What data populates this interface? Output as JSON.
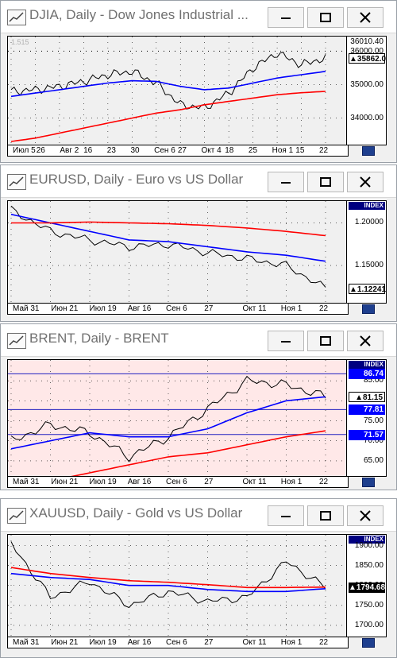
{
  "windows": [
    {
      "title": "DJIA, Daily - Dow Jones Industrial ...",
      "watermark": "1.515",
      "index_label": "",
      "price_label": "35862.00",
      "price_label_style": "white",
      "badges": [],
      "x_labels": [
        "Июл 5",
        "26",
        "Авг 2",
        "16",
        "23",
        "30",
        "Сен 6",
        "27",
        "Окт 4",
        "18",
        "25",
        "Ноя 1",
        "15",
        "22"
      ],
      "y_ticks": [
        "36010.40",
        "36000.00",
        "35000.00",
        "34000.00"
      ],
      "chart_data": {
        "type": "line",
        "title": "DJIA, Daily - Dow Jones Industrial ...",
        "ylim": [
          33300,
          36300
        ],
        "x": [
          "Июл 5",
          "26",
          "Авг 2",
          "16",
          "23",
          "30",
          "Сен 6",
          "27",
          "Окт 4",
          "18",
          "25",
          "Ноя 1",
          "15",
          "22"
        ],
        "series": [
          {
            "values": [
              34800,
              34850,
              34950,
              35100,
              35300,
              35400,
              35050,
              34400,
              34300,
              34750,
              35500,
              35950,
              35600,
              35800
            ],
            "color": "#000000"
          },
          {
            "values": [
              34650,
              34750,
              34850,
              34950,
              35050,
              35120,
              35100,
              34950,
              34850,
              34900,
              35050,
              35200,
              35300,
              35400
            ],
            "color": "#0000ff"
          },
          {
            "values": [
              33300,
              33400,
              33550,
              33700,
              33850,
              34000,
              34150,
              34250,
              34400,
              34500,
              34600,
              34700,
              34760,
              34800
            ],
            "color": "#ff0000"
          }
        ]
      }
    },
    {
      "title": "EURUSD, Daily - Euro vs US Dollar",
      "watermark": "",
      "index_label": "INDEX",
      "price_label": "1.12241",
      "price_label_style": "white",
      "badges": [],
      "x_labels": [
        "Май 31",
        "Июн 21",
        "Июл 19",
        "Авг 16",
        "Сен 6",
        "27",
        "Окт 11",
        "Ноя 1",
        "22"
      ],
      "y_ticks": [
        "1.20000",
        "1.15000"
      ],
      "chart_data": {
        "type": "line",
        "title": "EURUSD, Daily - Euro vs US Dollar",
        "ylim": [
          1.11,
          1.22
        ],
        "x": [
          "Май 31",
          "Июн 21",
          "Июл 19",
          "Авг 16",
          "Сен 6",
          "27",
          "Окт 11",
          "Ноя 1",
          "22"
        ],
        "series": [
          {
            "values": [
              1.215,
              1.19,
              1.18,
              1.172,
              1.175,
              1.165,
              1.158,
              1.15,
              1.123
            ],
            "color": "#000000"
          },
          {
            "values": [
              1.21,
              1.2,
              1.19,
              1.18,
              1.178,
              1.172,
              1.166,
              1.162,
              1.155
            ],
            "color": "#0000ff"
          },
          {
            "values": [
              1.2,
              1.2,
              1.201,
              1.2,
              1.199,
              1.197,
              1.194,
              1.19,
              1.185
            ],
            "color": "#ff0000"
          }
        ]
      }
    },
    {
      "title": "BRENT, Daily - BRENT",
      "watermark": "",
      "index_label": "INDEX",
      "price_label": "81.15",
      "price_label_style": "white",
      "badges": [
        {
          "text": "86.74",
          "bg": "#0000ff",
          "fg": "#ffffff"
        },
        {
          "text": "77.81",
          "bg": "#0000ff",
          "fg": "#ffffff"
        },
        {
          "text": "71.57",
          "bg": "#0000ff",
          "fg": "#ffffff"
        }
      ],
      "x_labels": [
        "Май 31",
        "Июн 21",
        "Июл 19",
        "Авг 16",
        "Сен 6",
        "27",
        "Окт 11",
        "Ноя 1",
        "22"
      ],
      "y_ticks": [
        "85.00",
        "80.00",
        "75.00",
        "70.00",
        "65.00"
      ],
      "chart_data": {
        "type": "line",
        "title": "BRENT, Daily - BRENT",
        "ylim": [
          62,
          89
        ],
        "x": [
          "Май 31",
          "Июн 21",
          "Июл 19",
          "Авг 16",
          "Сен 6",
          "27",
          "Окт 11",
          "Ноя 1",
          "22"
        ],
        "series": [
          {
            "values": [
              70,
              74,
              72,
              66,
              71,
              78,
              85,
              84,
              81
            ],
            "color": "#000000"
          },
          {
            "values": [
              68,
              70,
              72,
              71,
              71,
              73,
              77,
              80,
              81
            ],
            "color": "#0000ff"
          },
          {
            "values": [
              58,
              60,
              62,
              64,
              66,
              67,
              69,
              71,
              72.5
            ],
            "color": "#ff0000"
          }
        ],
        "hlines": [
          86.74,
          77.81,
          71.57
        ]
      }
    },
    {
      "title": "XAUUSD, Daily - Gold vs US Dollar",
      "watermark": "",
      "index_label": "INDEX",
      "price_label": "1794.68",
      "price_label_style": "black",
      "badges": [],
      "x_labels": [
        "Май 31",
        "Июн 21",
        "Июл 19",
        "Авг 16",
        "Сен 6",
        "27",
        "Окт 11",
        "Ноя 1",
        "22"
      ],
      "y_ticks": [
        "1900.00",
        "1850.00",
        "1800.00",
        "1750.00",
        "1700.00"
      ],
      "chart_data": {
        "type": "line",
        "title": "XAUUSD, Daily - Gold vs US Dollar",
        "ylim": [
          1680,
          1915
        ],
        "x": [
          "Май 31",
          "Июн 21",
          "Июл 19",
          "Авг 16",
          "Сен 6",
          "27",
          "Окт 11",
          "Ноя 1",
          "22"
        ],
        "series": [
          {
            "values": [
              1905,
              1770,
              1810,
              1750,
              1785,
              1760,
              1770,
              1860,
              1795
            ],
            "color": "#000000"
          },
          {
            "values": [
              1830,
              1820,
              1815,
              1800,
              1800,
              1790,
              1785,
              1785,
              1792
            ],
            "color": "#0000ff"
          },
          {
            "values": [
              1845,
              1830,
              1820,
              1812,
              1808,
              1802,
              1795,
              1795,
              1796
            ],
            "color": "#ff0000"
          }
        ]
      }
    }
  ]
}
